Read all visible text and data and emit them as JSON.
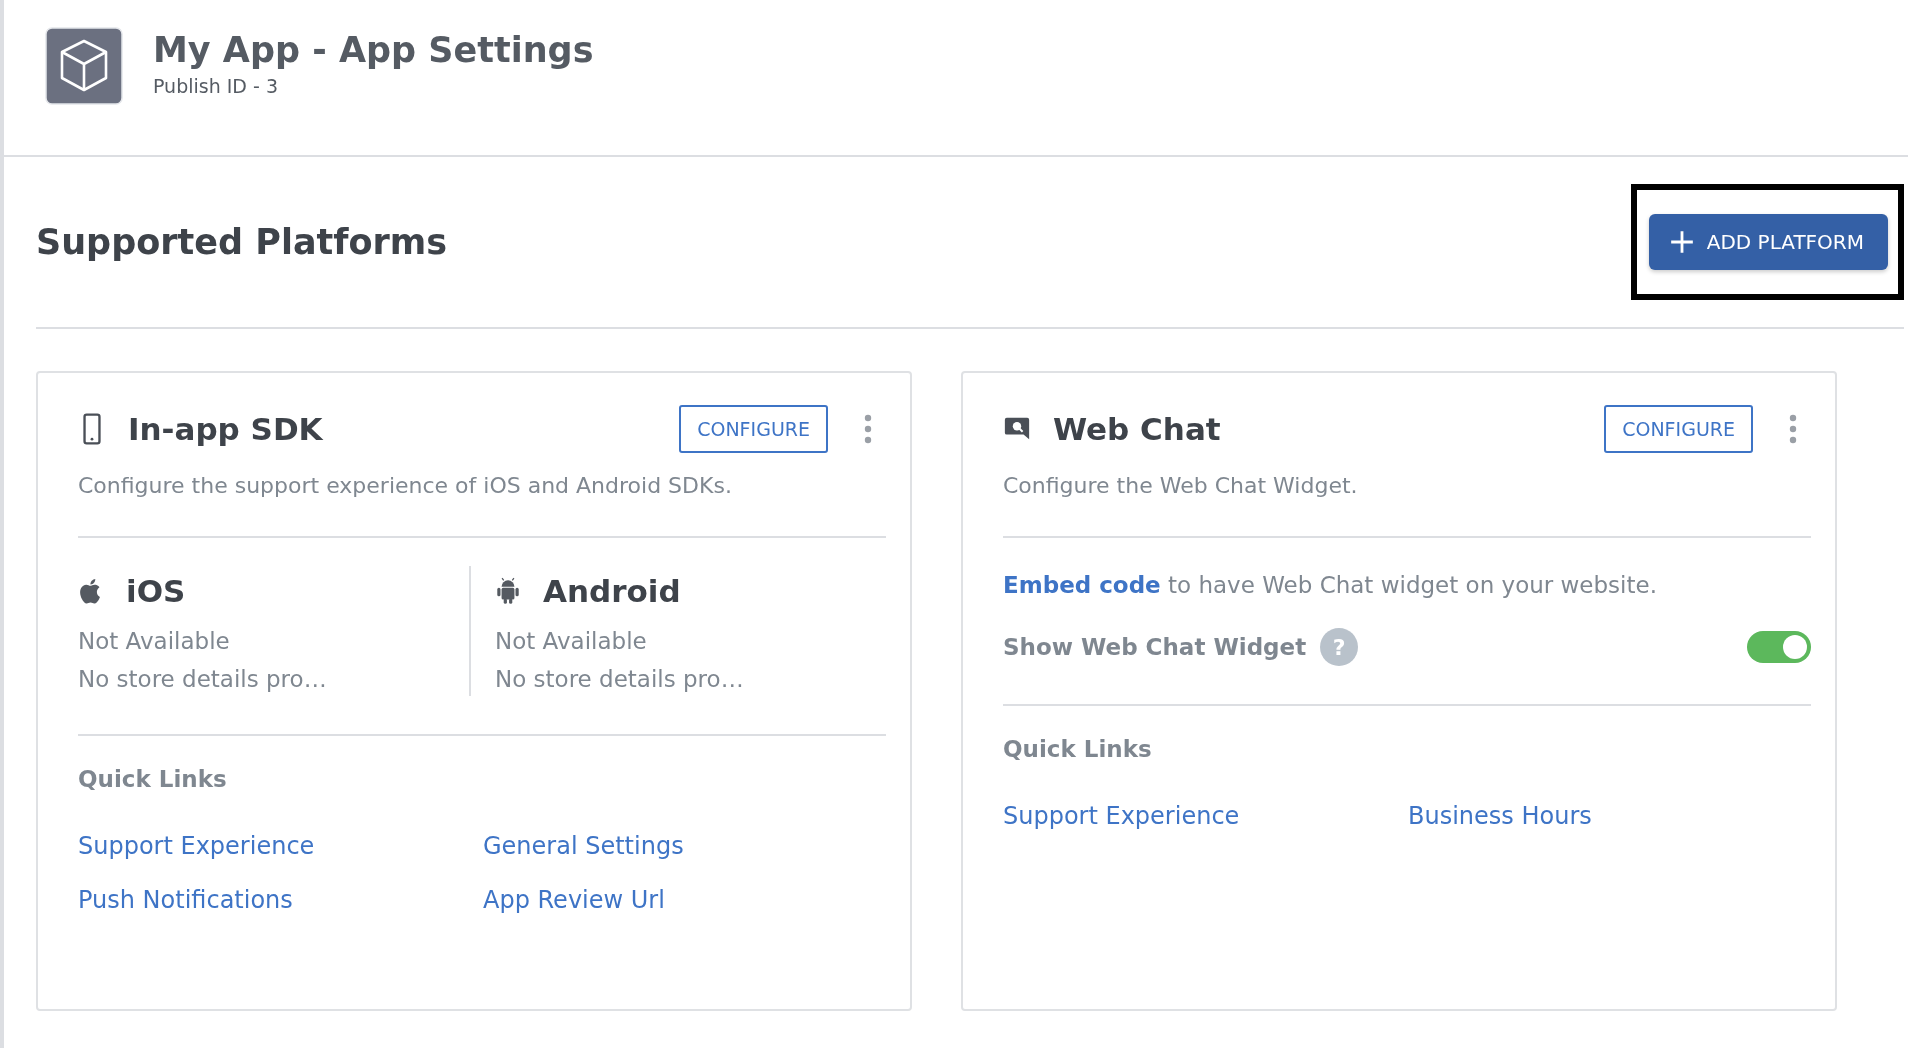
{
  "header": {
    "title": "My App - App Settings",
    "subtitle": "Publish ID - 3"
  },
  "section": {
    "title": "Supported Platforms",
    "add_button": {
      "label": "ADD PLATFORM",
      "highlighted": true
    }
  },
  "cards": [
    {
      "kind": "sdk",
      "title": "In-app SDK",
      "configure": "CONFIGURE",
      "description": "Configure the support experience of iOS and Android SDKs.",
      "platforms": [
        {
          "kind": "ios",
          "name": "iOS",
          "status": "Not Available",
          "details": "No store details pro…"
        },
        {
          "kind": "android",
          "name": "Android",
          "status": "Not Available",
          "details": "No store details pro…"
        }
      ],
      "quick_links_title": "Quick Links",
      "quick_links": [
        "Support Experience",
        "General Settings",
        "Push Notifications",
        "App Review Url"
      ]
    },
    {
      "kind": "webchat",
      "title": "Web Chat",
      "configure": "CONFIGURE",
      "description": "Configure the Web Chat Widget.",
      "embed_link": "Embed code",
      "embed_text": "to have Web Chat widget on your website.",
      "toggle": {
        "label": "Show Web Chat Widget",
        "help": "?",
        "on": true
      },
      "quick_links_title": "Quick Links",
      "quick_links": [
        "Support Experience",
        "Business Hours"
      ]
    }
  ]
}
